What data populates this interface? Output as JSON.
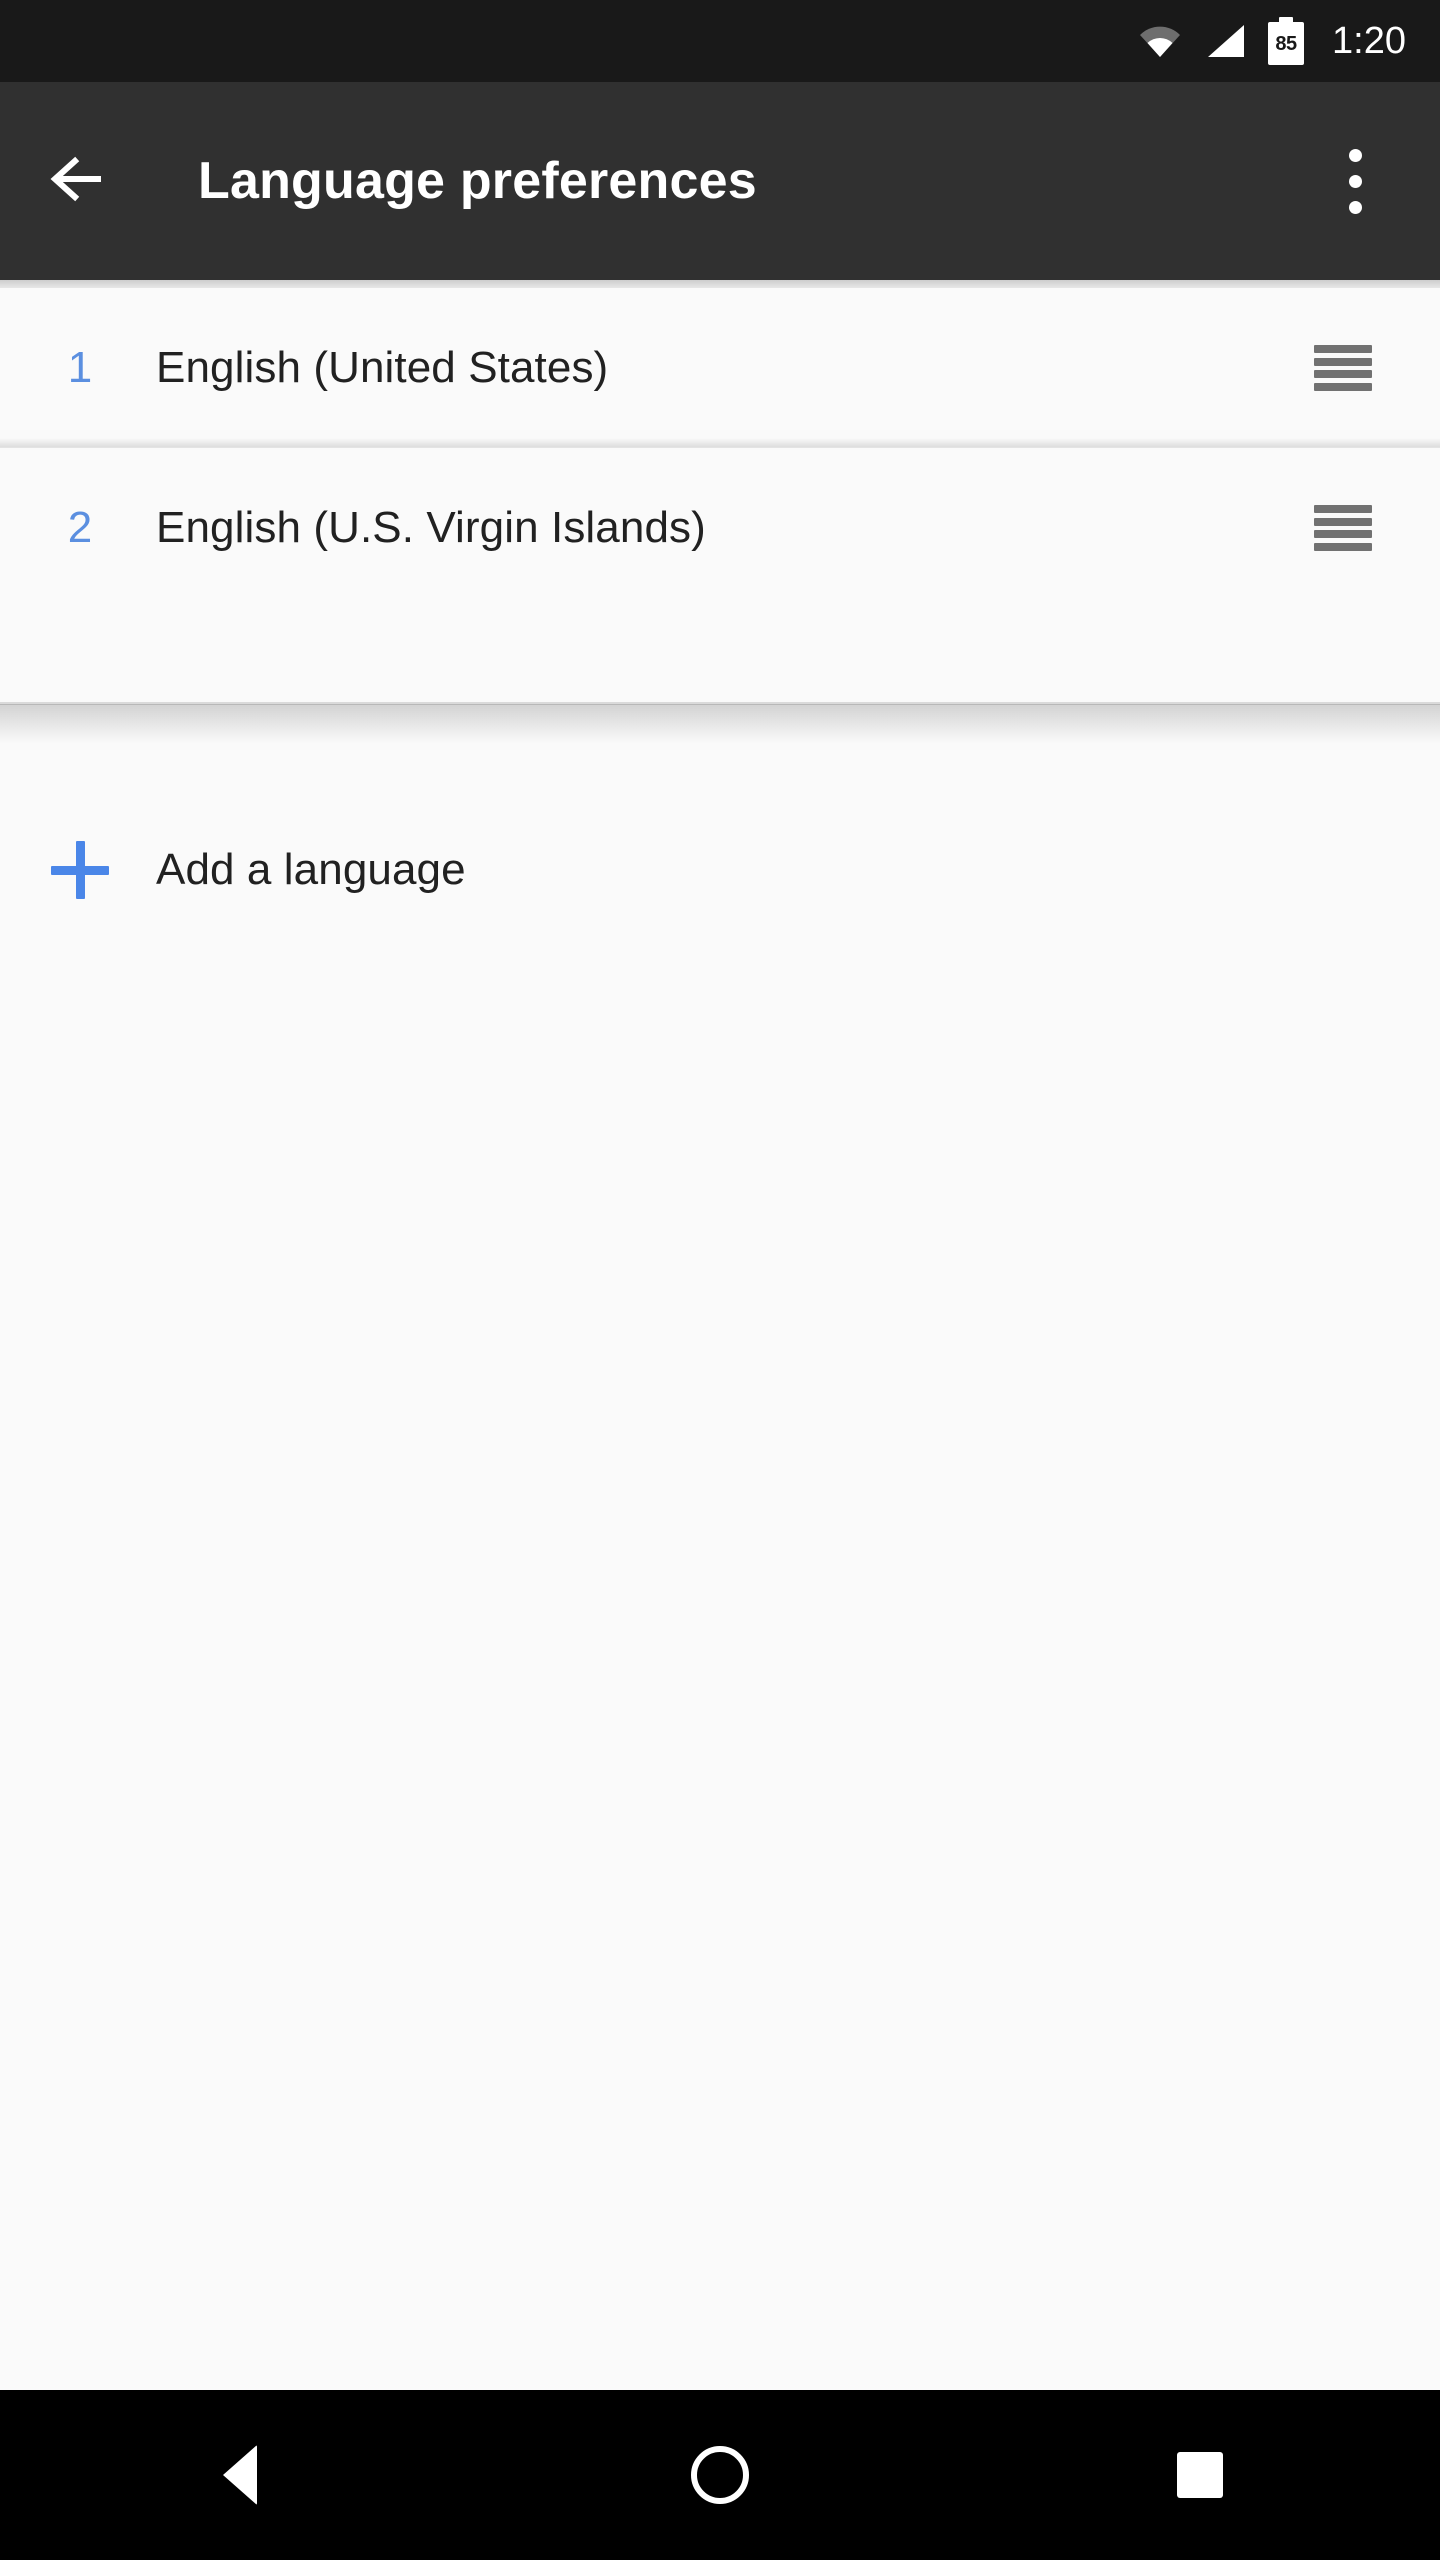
{
  "status_bar": {
    "wifi_icon": "wifi-icon",
    "signal_icon": "cellular-signal-icon",
    "battery_icon": "battery-icon",
    "battery_level": "85",
    "time": "1:20",
    "background_color": "#191919"
  },
  "app_bar": {
    "back_icon": "back-arrow-icon",
    "title": "Language preferences",
    "overflow_icon": "overflow-menu-icon",
    "background_color": "#303030",
    "title_color": "#ffffff"
  },
  "languages": {
    "accent_color": "#5b8fe0",
    "items": [
      {
        "index": "1",
        "label": "English (United States)",
        "drag_icon": "drag-handle-icon"
      },
      {
        "index": "2",
        "label": "English (U.S. Virgin Islands)",
        "drag_icon": "drag-handle-icon"
      }
    ]
  },
  "add_language": {
    "plus_icon": "plus-icon",
    "label": "Add a language",
    "accent_color": "#4a86e8"
  },
  "nav_bar": {
    "back_icon": "nav-back-triangle-icon",
    "home_icon": "nav-home-circle-icon",
    "recents_icon": "nav-recents-square-icon",
    "background_color": "#000000"
  },
  "page": {
    "background_color": "#fafafa",
    "text_color": "#212121"
  }
}
